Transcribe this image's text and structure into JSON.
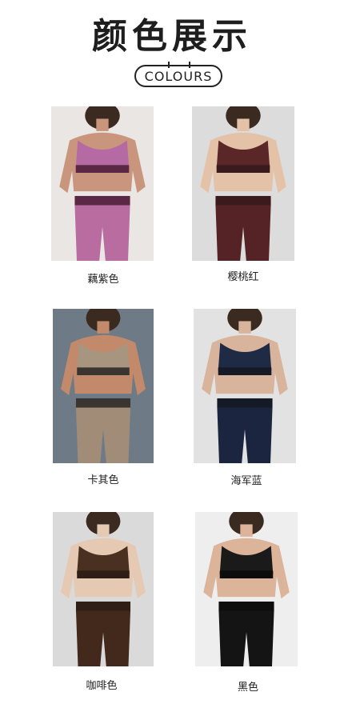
{
  "header": {
    "title": "颜色展示",
    "subtitle": "COLOURS"
  },
  "swatches": [
    {
      "label": "藕紫色",
      "top_color": "#b56aa3",
      "bottom_color": "#b86c9f",
      "band_color": "#5a2744",
      "bg": "#e9e6e4",
      "skin": "#c9957c"
    },
    {
      "label": "樱桃红",
      "top_color": "#5a2628",
      "bottom_color": "#552326",
      "band_color": "#3a1a1c",
      "bg": "#dcdcdc",
      "skin": "#e4c2a8"
    },
    {
      "label": "卡其色",
      "top_color": "#a89580",
      "bottom_color": "#a18d77",
      "band_color": "#3b3531",
      "bg": "#6f7a87",
      "skin": "#c28a6a"
    },
    {
      "label": "海军蓝",
      "top_color": "#1f2a45",
      "bottom_color": "#1c2540",
      "band_color": "#151a26",
      "bg": "#e2e2e2",
      "skin": "#d9b49c"
    },
    {
      "label": "咖啡色",
      "top_color": "#4a3020",
      "bottom_color": "#43291c",
      "band_color": "#2e1e16",
      "bg": "#dadada",
      "skin": "#e5c9b3"
    },
    {
      "label": "黑色",
      "top_color": "#1a1a1a",
      "bottom_color": "#141414",
      "band_color": "#0d0d0d",
      "bg": "#eeeeee",
      "skin": "#dcb49a"
    }
  ]
}
